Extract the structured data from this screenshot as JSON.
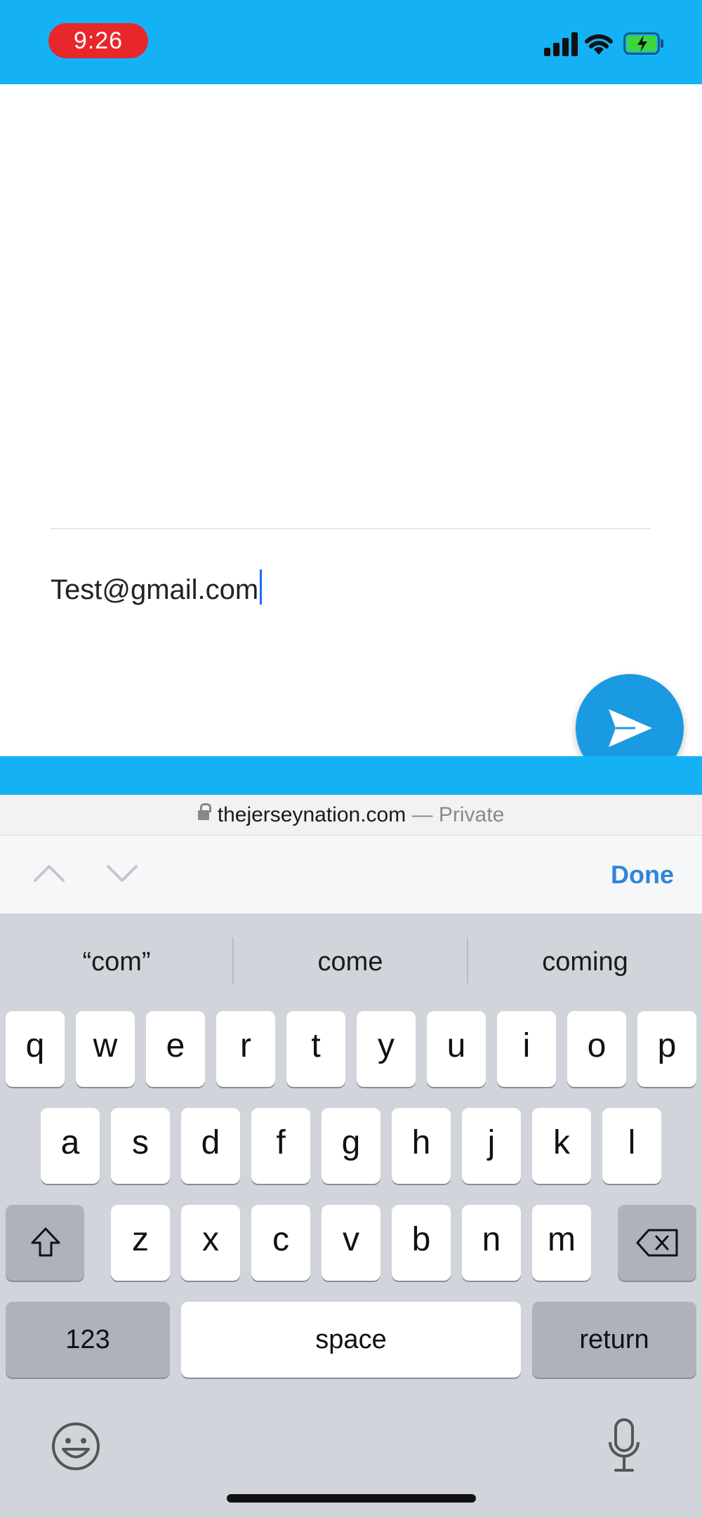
{
  "status_bar": {
    "time": "9:26"
  },
  "chat": {
    "input_value": "Test@gmail.com"
  },
  "url_bar": {
    "domain": "thejerseynation.com",
    "separator": " — ",
    "mode": "Private"
  },
  "accessory": {
    "done_label": "Done"
  },
  "keyboard": {
    "suggestions": [
      "“com”",
      "come",
      "coming"
    ],
    "row1": [
      "q",
      "w",
      "e",
      "r",
      "t",
      "y",
      "u",
      "i",
      "o",
      "p"
    ],
    "row2": [
      "a",
      "s",
      "d",
      "f",
      "g",
      "h",
      "j",
      "k",
      "l"
    ],
    "row3": [
      "z",
      "x",
      "c",
      "v",
      "b",
      "n",
      "m"
    ],
    "numbers_label": "123",
    "space_label": "space",
    "return_label": "return"
  },
  "colors": {
    "brand_blue": "#14b2f5",
    "send_blue": "#1a9ae0",
    "time_red": "#e8272b",
    "link_blue": "#2f86d8"
  }
}
